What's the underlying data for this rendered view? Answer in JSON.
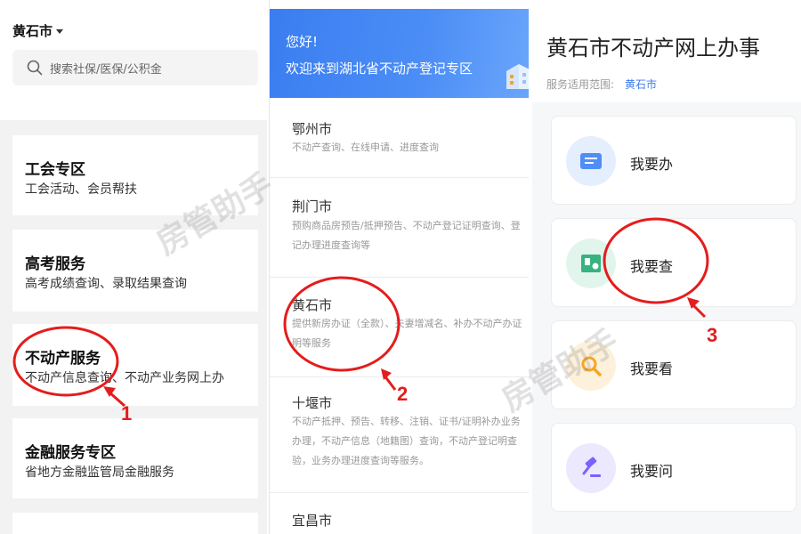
{
  "panel1": {
    "city_selector": "黄石市",
    "search_placeholder": "搜索社保/医保/公积金",
    "cards": [
      {
        "title": "工会专区",
        "subtitle": "工会活动、会员帮扶"
      },
      {
        "title": "高考服务",
        "subtitle": "高考成绩查询、录取结果查询"
      },
      {
        "title": "不动产服务",
        "subtitle": "不动产信息查询、不动产业务网上办"
      },
      {
        "title": "金融服务专区",
        "subtitle": "省地方金融监管局金融服务"
      }
    ]
  },
  "panel2": {
    "banner_greeting": "您好!",
    "banner_welcome": "欢迎来到湖北省不动产登记专区",
    "cities": [
      {
        "name": "鄂州市",
        "desc": "不动产查询、在线申请、进度查询"
      },
      {
        "name": "荆门市",
        "desc": "预购商品房预告/抵押预告、不动产登记证明查询、登记办理进度查询等"
      },
      {
        "name": "黄石市",
        "desc": "提供新房办证（全款）、夫妻增减名、补办不动产办证明等服务"
      },
      {
        "name": "十堰市",
        "desc": "不动产抵押、预告、转移、注销、证书/证明补办业务办理，不动产信息（地籍图）查询，不动产登记明查验，业务办理进度查询等服务。"
      },
      {
        "name": "宜昌市",
        "desc": ""
      }
    ]
  },
  "panel3": {
    "title": "黄石市不动产网上办事",
    "scope_label": "服务适用范围:",
    "scope_city": "黄石市",
    "services": [
      {
        "label": "我要办",
        "icon": "form-icon",
        "color": "#4f8ef7"
      },
      {
        "label": "我要查",
        "icon": "certificate-icon",
        "color": "#36b37e"
      },
      {
        "label": "我要看",
        "icon": "magnifier-icon",
        "color": "#f5a623"
      },
      {
        "label": "我要问",
        "icon": "gavel-icon",
        "color": "#7b61ff"
      }
    ]
  },
  "annotations": {
    "steps": [
      "1",
      "2",
      "3"
    ],
    "highlight_color": "#e51c1c"
  },
  "watermark": "房管助手"
}
